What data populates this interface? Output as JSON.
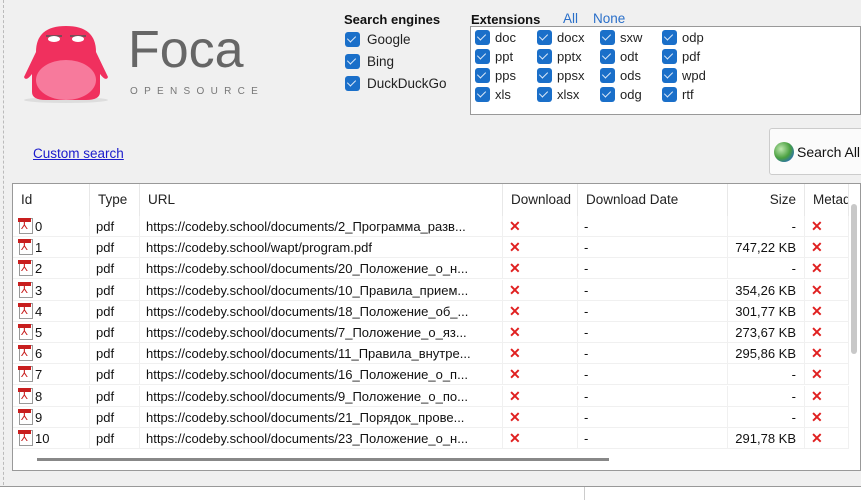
{
  "logo": {
    "name": "Foca",
    "sub": "OPENSOURCE"
  },
  "search_engines": {
    "title": "Search engines",
    "items": [
      {
        "label": "Google",
        "checked": true
      },
      {
        "label": "Bing",
        "checked": true
      },
      {
        "label": "DuckDuckGo",
        "checked": true
      }
    ]
  },
  "extensions": {
    "title": "Extensions",
    "all": "All",
    "none": "None",
    "items": [
      "doc",
      "docx",
      "sxw",
      "odp",
      "ppt",
      "pptx",
      "odt",
      "pdf",
      "pps",
      "ppsx",
      "ods",
      "wpd",
      "xls",
      "xlsx",
      "odg",
      "rtf"
    ]
  },
  "custom_search": "Custom search",
  "search_all": "Search All",
  "table": {
    "columns": [
      "Id",
      "Type",
      "URL",
      "Download",
      "Download Date",
      "Size",
      "Metad"
    ],
    "rows": [
      [
        "0",
        "pdf",
        "https://codeby.school/documents/2_Программа_разв...",
        "-",
        "-"
      ],
      [
        "1",
        "pdf",
        "https://codeby.school/wapt/program.pdf",
        "-",
        "747,22 KB"
      ],
      [
        "2",
        "pdf",
        "https://codeby.school/documents/20_Положение_о_н...",
        "-",
        "-"
      ],
      [
        "3",
        "pdf",
        "https://codeby.school/documents/10_Правила_прием...",
        "-",
        "354,26 KB"
      ],
      [
        "4",
        "pdf",
        "https://codeby.school/documents/18_Положение_об_...",
        "-",
        "301,77 KB"
      ],
      [
        "5",
        "pdf",
        "https://codeby.school/documents/7_Положение_о_яз...",
        "-",
        "273,67 KB"
      ],
      [
        "6",
        "pdf",
        "https://codeby.school/documents/11_Правила_внутре...",
        "-",
        "295,86 KB"
      ],
      [
        "7",
        "pdf",
        "https://codeby.school/documents/16_Положение_о_п...",
        "-",
        "-"
      ],
      [
        "8",
        "pdf",
        "https://codeby.school/documents/9_Положение_о_по...",
        "-",
        "-"
      ],
      [
        "9",
        "pdf",
        "https://codeby.school/documents/21_Порядок_прове...",
        "-",
        "-"
      ],
      [
        "10",
        "pdf",
        "https://codeby.school/documents/23_Положение_о_н...",
        "-",
        "291,78 KB"
      ]
    ],
    "status_mark": "✕"
  }
}
